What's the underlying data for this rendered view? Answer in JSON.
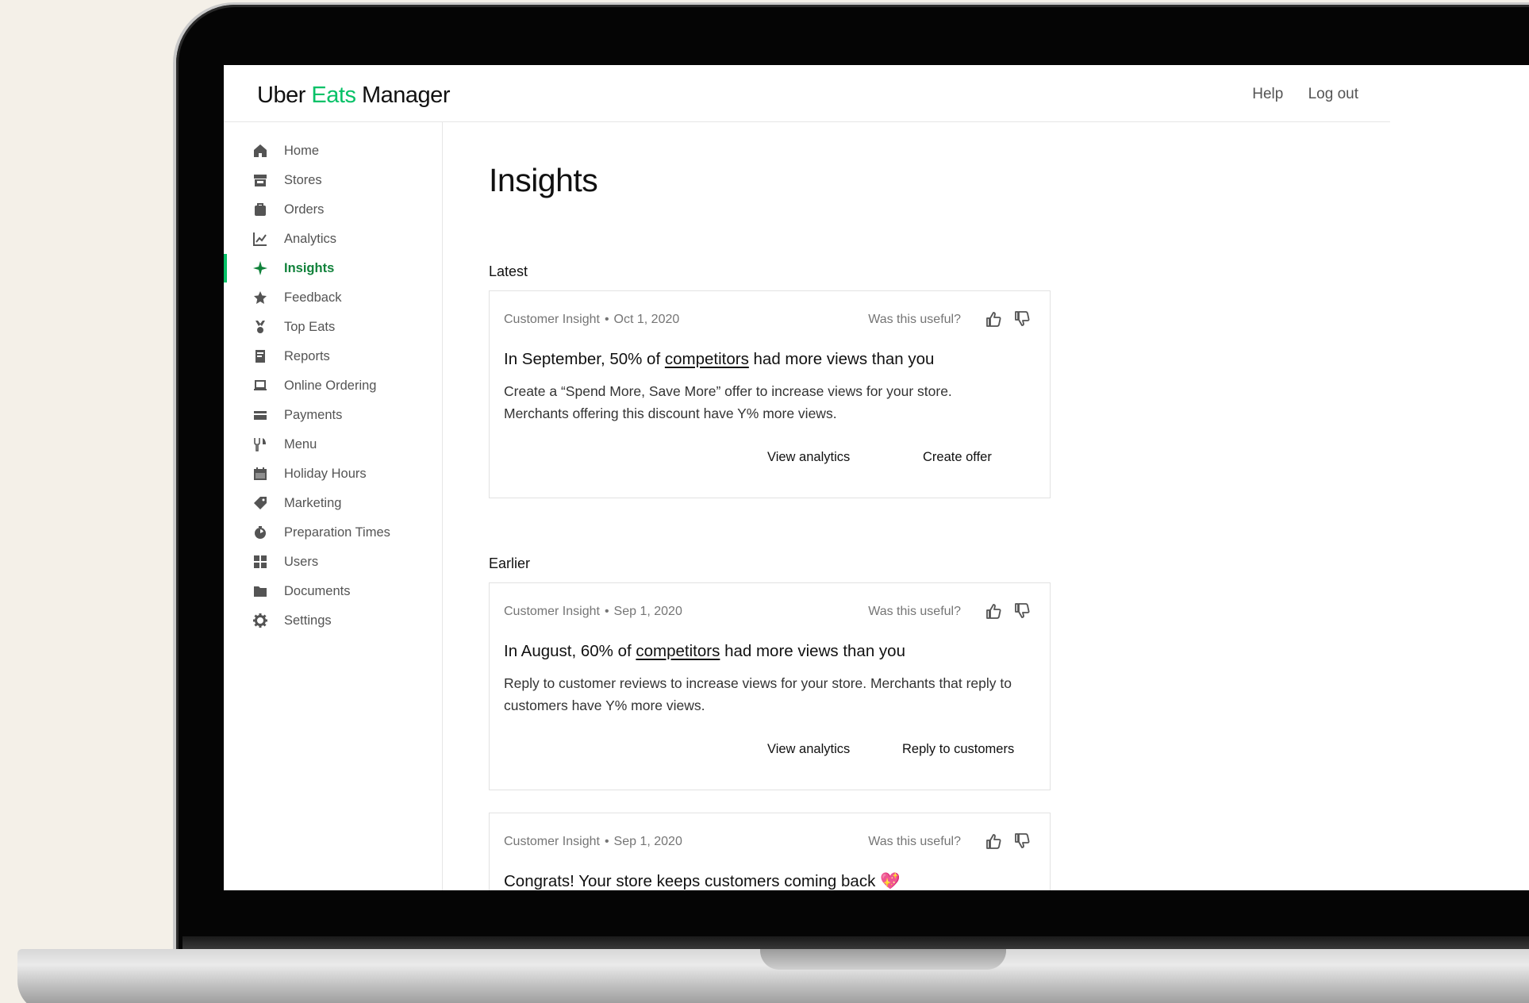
{
  "header": {
    "logo_uber": "Uber",
    "logo_eats": "Eats",
    "logo_manager": "Manager",
    "help": "Help",
    "logout": "Log out"
  },
  "sidebar": {
    "items": [
      {
        "label": "Home",
        "icon": "home-icon"
      },
      {
        "label": "Stores",
        "icon": "store-icon"
      },
      {
        "label": "Orders",
        "icon": "bag-icon"
      },
      {
        "label": "Analytics",
        "icon": "chart-line-icon"
      },
      {
        "label": "Insights",
        "icon": "sparkle-icon",
        "active": true
      },
      {
        "label": "Feedback",
        "icon": "star-icon"
      },
      {
        "label": "Top Eats",
        "icon": "medal-icon"
      },
      {
        "label": "Reports",
        "icon": "report-icon"
      },
      {
        "label": "Online Ordering",
        "icon": "laptop-icon"
      },
      {
        "label": "Payments",
        "icon": "card-icon"
      },
      {
        "label": "Menu",
        "icon": "utensils-icon"
      },
      {
        "label": "Holiday Hours",
        "icon": "calendar-icon"
      },
      {
        "label": "Marketing",
        "icon": "tag-icon"
      },
      {
        "label": "Preparation Times",
        "icon": "timer-icon"
      },
      {
        "label": "Users",
        "icon": "users-icon"
      },
      {
        "label": "Documents",
        "icon": "folder-icon"
      },
      {
        "label": "Settings",
        "icon": "gear-icon"
      }
    ]
  },
  "main": {
    "title": "Insights",
    "section_latest": "Latest",
    "section_earlier": "Earlier",
    "cards": [
      {
        "type": "Customer Insight",
        "dot": "•",
        "date": "Oct 1, 2020",
        "useful": "Was this useful?",
        "title_pre": "In September, 50% of ",
        "title_link": "competitors",
        "title_post": " had more views than you",
        "body": "Create a “Spend More, Save More” offer to increase views for your store. Merchants offering this discount have Y% more views.",
        "action1": "View analytics",
        "action2": "Create offer"
      },
      {
        "type": "Customer Insight",
        "dot": "•",
        "date": "Sep 1, 2020",
        "useful": "Was this useful?",
        "title_pre": "In August, 60% of ",
        "title_link": "competitors",
        "title_post": " had more views than you",
        "body": "Reply to customer reviews to increase  views for your store. Merchants that reply to customers have Y% more views.",
        "action1": "View analytics",
        "action2": "Reply to customers"
      },
      {
        "type": "Customer Insight",
        "dot": "•",
        "date": "Sep 1, 2020",
        "useful": "Was this useful?",
        "title": "Congrats! Your store keeps customers coming back 💖"
      }
    ]
  },
  "colors": {
    "brand_green": "#06c167",
    "active_green": "#11823b"
  }
}
